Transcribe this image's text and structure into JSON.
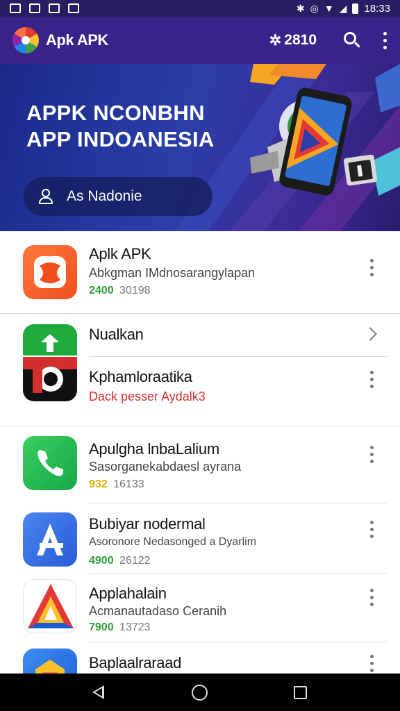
{
  "status_bar": {
    "time": "18:33",
    "icons": [
      "image-icon",
      "cat-icon",
      "lock-icon",
      "key-icon",
      "bluetooth-icon",
      "alarm-icon",
      "wifi-icon",
      "signal-icon",
      "battery-icon"
    ]
  },
  "app_bar": {
    "title": "Apk APK",
    "rating": "2810",
    "icons": [
      "logo-icon",
      "star-icon",
      "search-icon",
      "more-vert-icon"
    ]
  },
  "banner": {
    "title_line1": "APPK NCONBHN",
    "title_line2": "APP INDOANESIA",
    "search_label": "As Nadonie",
    "icons": [
      "user-icon",
      "phone-illustration"
    ]
  },
  "list": [
    {
      "name": "Aplk APK",
      "description": "Abkgman IMdnosarangylapan",
      "score": "2400",
      "count": "30198",
      "score_color": "green",
      "action": "more-vert-icon",
      "icon_colors": [
        "#f05a28",
        "#ff8a3d"
      ]
    },
    {
      "name": "Nualkan",
      "description": "",
      "score": "",
      "count": "",
      "action": "chevron-right-icon",
      "icon_colors": [
        "#1faa3c",
        "#34c759"
      ]
    },
    {
      "name": "Kphamloraatika",
      "description": "Dack pesser Aydalk3",
      "score": "",
      "count": "",
      "action": "more-vert-icon",
      "desc_color": "#d32f2f",
      "icon_colors": [
        "#111111",
        "#d32f2f"
      ]
    },
    {
      "name": "Apulgha lnbaLalium",
      "description": "Sasorganekabdaesl ayrana",
      "score": "932",
      "count": "16133",
      "score_color": "gold",
      "action": "more-vert-icon",
      "icon_colors": [
        "#17a64a",
        "#39d05f"
      ]
    },
    {
      "name": "Bubiyar nodermal",
      "description": "Asoronore Nedasonged a Dyarlim",
      "score": "4900",
      "count": "26122",
      "score_color": "green",
      "action": "more-vert-icon",
      "icon_colors": [
        "#2a5bd7",
        "#4a86f0"
      ]
    },
    {
      "name": "Applahalain",
      "description": "Acmanautadaso Ceranih",
      "score": "7900",
      "count": "13723",
      "score_color": "green",
      "action": "more-vert-icon",
      "icon_colors": [
        "#e53935",
        "#fbc02d"
      ]
    },
    {
      "name": "Baplaalraraad",
      "description": "",
      "score": "",
      "count": "",
      "action": "more-vert-icon",
      "icon_colors": [
        "#1e88e5",
        "#fbc02d"
      ]
    }
  ],
  "nav_bar": {
    "icons": [
      "back-icon",
      "home-icon",
      "recents-icon"
    ]
  }
}
